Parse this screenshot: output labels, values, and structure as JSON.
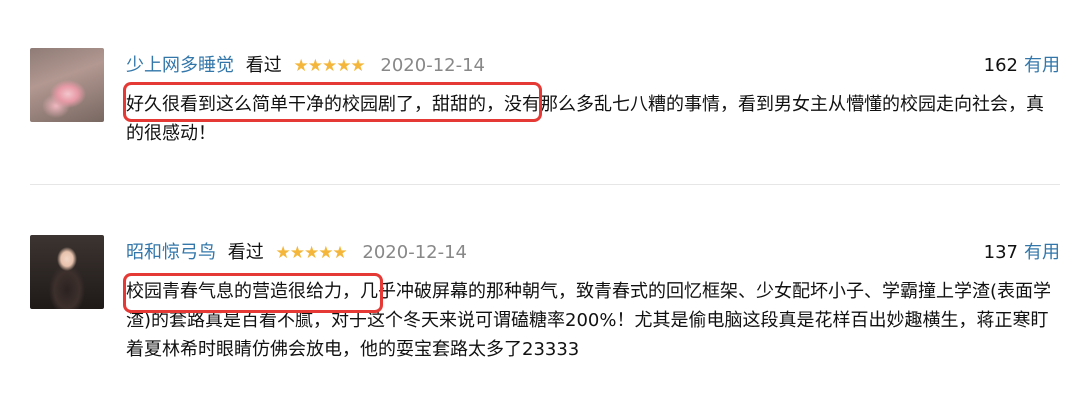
{
  "comments": [
    {
      "username": "少上网多睡觉",
      "status": "看过",
      "stars": "★★★★★",
      "date": "2020-12-14",
      "votes": "162",
      "useful_label": "有用",
      "text": "好久很看到这么简单干净的校园剧了，甜甜的，没有那么多乱七八糟的事情，看到男女主从懵懂的校园走向社会，真的很感动！"
    },
    {
      "username": "昭和惊弓鸟",
      "status": "看过",
      "stars": "★★★★★",
      "date": "2020-12-14",
      "votes": "137",
      "useful_label": "有用",
      "text": "校园青春气息的营造很给力，几乎冲破屏幕的那种朝气，致青春式的回忆框架、少女配坏小子、学霸撞上学渣(表面学渣)的套路真是百看不腻，对于这个冬天来说可谓磕糖率200%！尤其是偷电脑这段真是花样百出妙趣横生，蒋正寒盯着夏林希时眼睛仿佛会放电，他的耍宝套路太多了23333"
    }
  ],
  "colors": {
    "link": "#3377aa",
    "star": "#f4b73b",
    "highlight_box": "#e53935",
    "date": "#888888"
  }
}
